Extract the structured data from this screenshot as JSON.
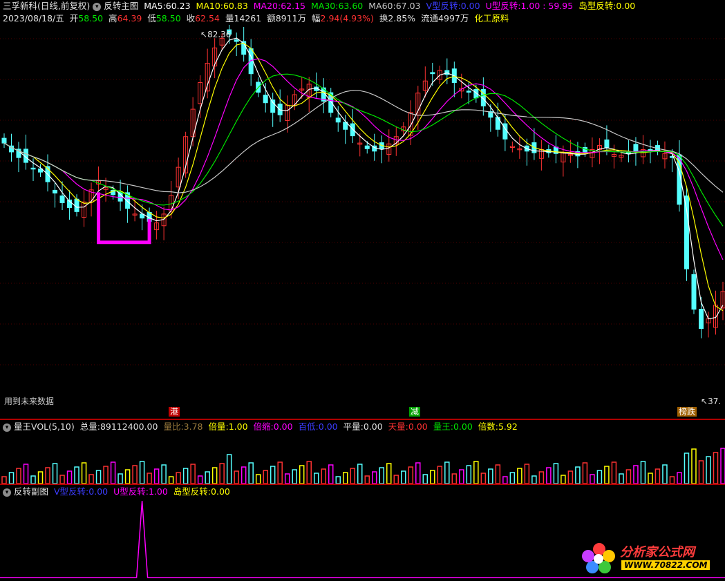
{
  "header": {
    "stock_name": "三孚新科(日线,前复权)",
    "indicator_name": "反转主图",
    "ma5_label": "MA5:",
    "ma5_value": "60.23",
    "ma10_label": "MA10:",
    "ma10_value": "60.83",
    "ma20_label": "MA20:",
    "ma20_value": "62.15",
    "ma30_label": "MA30:",
    "ma30_value": "63.60",
    "ma60_label": "MA60:",
    "ma60_value": "67.03",
    "v_label": "V型反转:",
    "v_value": "0.00",
    "u_label": "U型反转:",
    "u_value": "1.00 : 59.95",
    "island_label": "岛型反转:",
    "island_value": "0.00"
  },
  "quote": {
    "date": "2023/08/18/五",
    "open_label": "开",
    "open": "58.50",
    "high_label": "高",
    "high": "64.39",
    "low_label": "低",
    "low": "58.50",
    "close_label": "收",
    "close": "62.54",
    "volume_label": "量",
    "volume": "14261",
    "amount_label": "额",
    "amount": "8911万",
    "change_label": "幅",
    "change": "2.94(4.93%)",
    "turnover_label": "换",
    "turnover": "2.85%",
    "float_label": "流通",
    "float": "4997万",
    "sector": "化工原料"
  },
  "main_chart": {
    "high_marker": "82.36",
    "low_marker": "37.",
    "future_data_note": "用到未来数据",
    "markers": [
      "港",
      "减",
      "榜跌"
    ]
  },
  "vol_panel": {
    "title": "量王VOL(5,10)",
    "total_label": "总量:",
    "total_value": "89112400.00",
    "ratio_label": "量比:",
    "ratio_value": "3.78",
    "double_label": "倍量:",
    "double_value": "1.00",
    "shrink_label": "倍缩:",
    "shrink_value": "0.00",
    "low_label": "百低:",
    "low_value": "0.00",
    "flat_label": "平量:",
    "flat_value": "0.00",
    "sky_label": "天量:",
    "sky_value": "0.00",
    "king_label": "量王:",
    "king_value": "0.00",
    "mult_label": "倍数:",
    "mult_value": "5.92"
  },
  "sub_panel": {
    "title": "反转副图",
    "v_label": "V型反转:",
    "v_value": "0.00",
    "u_label": "U型反转:",
    "u_value": "1.00",
    "island_label": "岛型反转:",
    "island_value": "0.00"
  },
  "logo": {
    "brand": "分析家公式网",
    "url": "WWW.70822.COM"
  },
  "colors": {
    "up": "#ff3232",
    "down": "#54ffff",
    "ma5": "#ffffff",
    "ma10": "#ffff00",
    "ma20": "#ff00ff",
    "ma30": "#00e600",
    "ma60": "#c8c8c8",
    "accent": "#ff00ff"
  },
  "price_series": [
    68.6,
    67.5,
    66.8,
    66.2,
    65.4,
    65.0,
    63.8,
    62.4,
    61.2,
    60.6,
    60.1,
    61.3,
    62.8,
    63.9,
    63.1,
    62.2,
    61.4,
    60.5,
    59.8,
    59.3,
    58.9,
    58.7,
    59.8,
    62.1,
    65.6,
    69.4,
    72.8,
    76.1,
    78.5,
    80.4,
    81.6,
    82.1,
    81.2,
    79.6,
    77.2,
    74.9,
    73.6,
    72.4,
    72.1,
    73.3,
    74.6,
    75.3,
    75.9,
    75.1,
    73.8,
    72.4,
    71.2,
    70.3,
    69.5,
    68.6,
    67.9,
    67.6,
    67.9,
    68.5,
    69.4,
    70.6,
    72.4,
    74.8,
    76.3,
    77.2,
    77.6,
    77.1,
    76.1,
    75.4,
    74.9,
    74.2,
    73.2,
    71.8,
    70.3,
    69.1,
    68.2,
    67.9,
    67.6,
    67.4,
    67.8,
    67.4,
    67.3,
    67.4,
    67.2,
    67.0,
    67.5,
    67.8,
    68.3,
    68.0,
    67.2,
    67.1,
    67.4,
    67.6,
    67.8,
    67.6,
    67.7,
    67.3,
    66.8,
    61.0,
    53.0,
    48.0,
    45.6,
    46.8,
    48.5,
    50.2
  ]
}
